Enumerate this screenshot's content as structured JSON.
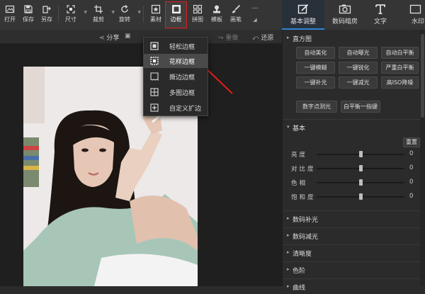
{
  "toolbar": {
    "open": "打开",
    "save": "保存",
    "save_as": "另存",
    "size": "尺寸",
    "crop": "裁剪",
    "rotate": "旋转",
    "material": "素材",
    "border": "边框",
    "collage": "拼图",
    "template": "模板",
    "brush": "画笔"
  },
  "subbar": {
    "share": "分享",
    "redo": "重做",
    "restore": "还原"
  },
  "dropdown": [
    "轻松边框",
    "花样边框",
    "撕边边框",
    "多图边框",
    "自定义扩边"
  ],
  "panel_tabs": [
    "基本调整",
    "数码暗房",
    "文字",
    "水印"
  ],
  "histogram_section": {
    "title": "直方图",
    "buttons": [
      "自动美化",
      "自动曝光",
      "自动白平衡",
      "一键模糊",
      "一键锐化",
      "严重白平衡",
      "一键补光",
      "一键减光",
      "高ISO降噪"
    ],
    "extra_buttons": [
      "数字点测光",
      "白平衡一指键"
    ]
  },
  "basic_section": {
    "title": "基本",
    "reset": "重置",
    "sliders": [
      {
        "label": "亮度",
        "value": "0",
        "level": 0.5
      },
      {
        "label": "对比度",
        "value": "0",
        "level": 0.5
      },
      {
        "label": "色相",
        "value": "0",
        "level": 0.5
      },
      {
        "label": "饱和度",
        "value": "0",
        "level": 0.5
      }
    ]
  },
  "collapsed_sections": [
    "数码补光",
    "数码减光",
    "清晰度",
    "色阶",
    "曲线"
  ],
  "colors": {
    "highlight": "#e81a1a",
    "accent": "#2f86d6"
  }
}
